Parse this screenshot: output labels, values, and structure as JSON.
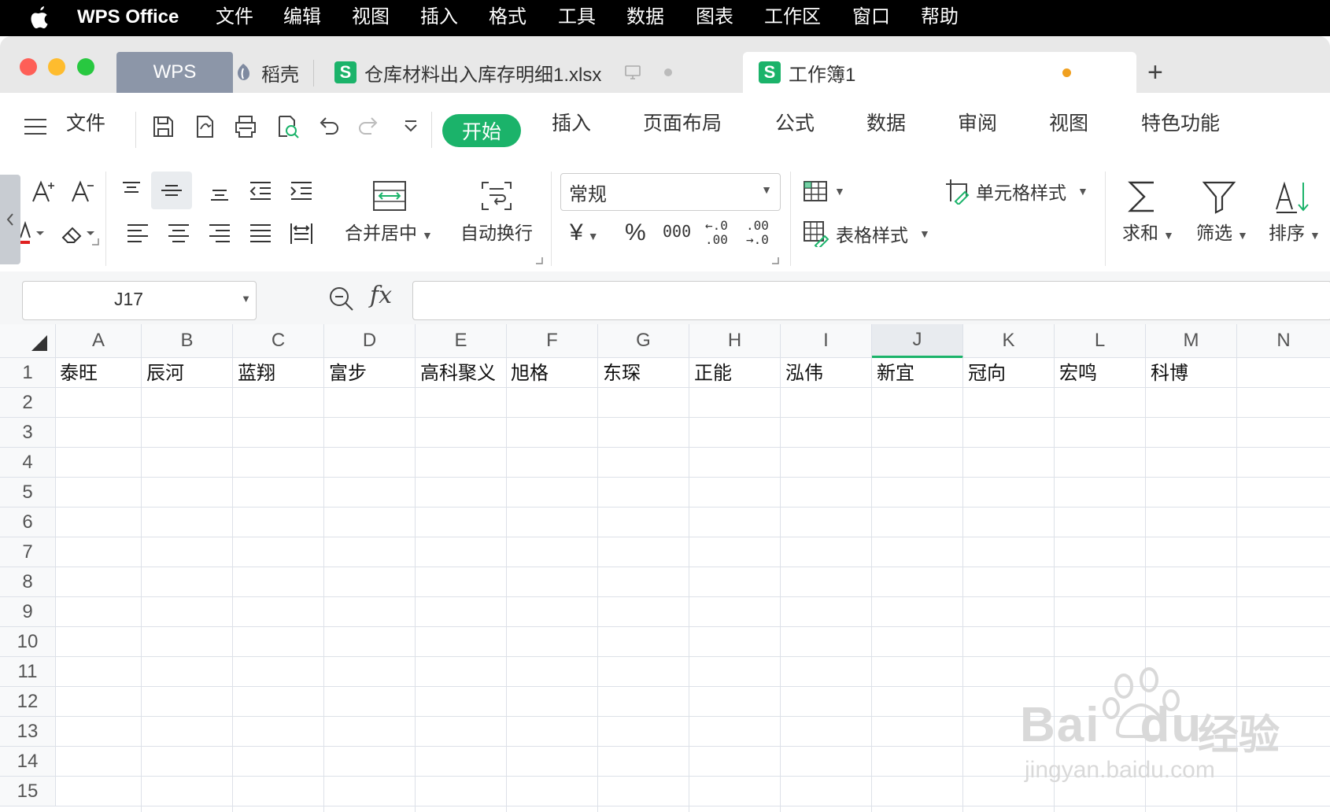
{
  "menubar": {
    "app": "WPS Office",
    "items": [
      "文件",
      "编辑",
      "视图",
      "插入",
      "格式",
      "工具",
      "数据",
      "图表",
      "工作区",
      "窗口",
      "帮助"
    ]
  },
  "tabs": {
    "wps": "WPS",
    "docer": "稻壳",
    "file1": "仓库材料出入库存明细1.xlsx",
    "active": "工作簿1",
    "add": "+"
  },
  "toolbar": {
    "file": "文件",
    "ribbon_tabs": [
      "开始",
      "插入",
      "页面布局",
      "公式",
      "数据",
      "审阅",
      "视图",
      "特色功能"
    ]
  },
  "ribbon": {
    "merge": "合并居中",
    "wrap": "自动换行",
    "number_format": "常规",
    "cell_style": "单元格样式",
    "table_style": "表格样式",
    "sum": "求和",
    "filter": "筛选",
    "sort": "排序",
    "thousands": "000",
    "inc_decimal_a": "←.0",
    "inc_decimal_b": ".00",
    "dec_decimal_a": ".00",
    "dec_decimal_b": "→.0",
    "currency": "¥",
    "percent": "%"
  },
  "formula_bar": {
    "name_box": "J17",
    "fx": "fx",
    "value": ""
  },
  "sheet": {
    "columns": [
      "A",
      "B",
      "C",
      "D",
      "E",
      "F",
      "G",
      "H",
      "I",
      "J",
      "K",
      "L",
      "M",
      "N"
    ],
    "rows": [
      "1",
      "2",
      "3",
      "4",
      "5",
      "6",
      "7",
      "8",
      "9",
      "10",
      "11",
      "12",
      "13",
      "14",
      "15"
    ],
    "row1": [
      "泰旺",
      "辰河",
      "蓝翔",
      "富步",
      "高科聚义",
      "旭格",
      "东琛",
      "正能",
      "泓伟",
      "新宜",
      "冠向",
      "宏鸣",
      "科博",
      ""
    ],
    "selected_column": "J"
  },
  "watermark": {
    "brand": "Bai",
    "brand2": "du",
    "suffix": "经验",
    "url": "jingyan.baidu.com"
  },
  "colors": {
    "accent": "#1bb36a",
    "menubar": "#000000",
    "tab_wps": "#8c96a8",
    "close": "#fe5f57",
    "minimize": "#febc2e",
    "maximize": "#28c840",
    "unsaved_dot": "#f0a020"
  }
}
